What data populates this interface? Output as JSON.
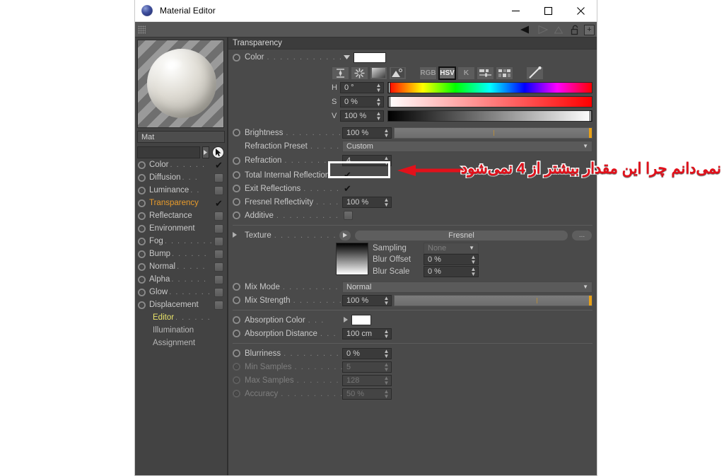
{
  "window": {
    "title": "Material Editor",
    "logo_icon": "cinema4d-sphere-icon",
    "minimize_label": "—",
    "maximize_label": "□",
    "close_label": "✕"
  },
  "toolstrip": {
    "grip_icon": "drag-grip-icon",
    "back_icon": "back-arrow-icon",
    "forward_icon": "forward-arrow-icon",
    "up_icon": "up-arrow-icon",
    "lock_icon": "lock-open-icon",
    "add_icon": "add-box-icon",
    "add_label": "+"
  },
  "preview": {
    "sphere_icon": "material-preview-sphere",
    "material_name": "Mat",
    "search_value": "",
    "search_dropdown_icon": "chevron-right-icon",
    "cursor_icon": "pointer-arrow-icon"
  },
  "channels": [
    {
      "label": "Color",
      "dots": ". . . . . .",
      "state": "checked",
      "active": false
    },
    {
      "label": "Diffusion",
      "dots": ". . .",
      "state": "box",
      "active": false
    },
    {
      "label": "Luminance",
      "dots": ". .",
      "state": "box",
      "active": false
    },
    {
      "label": "Transparency",
      "dots": "",
      "state": "checked",
      "active": true
    },
    {
      "label": "Reflectance",
      "dots": "",
      "state": "box",
      "active": false
    },
    {
      "label": "Environment",
      "dots": "",
      "state": "box",
      "active": false
    },
    {
      "label": "Fog",
      "dots": ". . . . . . . .",
      "state": "box",
      "active": false
    },
    {
      "label": "Bump",
      "dots": ". . . . . .",
      "state": "box",
      "active": false
    },
    {
      "label": "Normal",
      "dots": ". . . . .",
      "state": "box",
      "active": false
    },
    {
      "label": "Alpha",
      "dots": ". . . . . .",
      "state": "box",
      "active": false
    },
    {
      "label": "Glow",
      "dots": ". . . . . . .",
      "state": "box",
      "active": false
    },
    {
      "label": "Displacement",
      "dots": "",
      "state": "box",
      "active": false
    }
  ],
  "sub_pages": [
    {
      "label": "Editor",
      "dots": ". . . . . .",
      "selected": true
    },
    {
      "label": "Illumination",
      "dots": "",
      "selected": false
    },
    {
      "label": "Assignment",
      "dots": "",
      "selected": false
    }
  ],
  "section": {
    "header": "Transparency"
  },
  "color": {
    "label": "Color",
    "dots": ". . . . . . . . . . . .",
    "dropdown_icon": "chevron-down-icon",
    "swatch_hex": "#ffffff",
    "mode_buttons": [
      {
        "name": "range-icon",
        "label": "⧖",
        "selected": false
      },
      {
        "name": "color-wheel-icon",
        "label": "✳",
        "selected": false
      },
      {
        "name": "gradient-icon",
        "label": "",
        "selected": false
      },
      {
        "name": "image-icon",
        "label": "▲",
        "selected": false
      },
      {
        "name": "rgb-mode",
        "label": "RGB",
        "selected": false
      },
      {
        "name": "hsv-mode",
        "label": "HSV",
        "selected": true
      },
      {
        "name": "kelvin-mode",
        "label": "K",
        "selected": false
      },
      {
        "name": "sliders-icon",
        "label": "",
        "selected": false
      },
      {
        "name": "swatches-icon",
        "label": "",
        "selected": false
      },
      {
        "name": "eyedropper-icon",
        "label": "",
        "selected": false
      }
    ],
    "hsv": [
      {
        "channel": "H",
        "value": "0 °",
        "pos_percent": 0
      },
      {
        "channel": "S",
        "value": "0 %",
        "pos_percent": 0
      },
      {
        "channel": "V",
        "value": "100 %",
        "pos_percent": 100
      }
    ]
  },
  "properties": {
    "brightness": {
      "label": "Brightness",
      "dots": ". . . . . . . . . . .",
      "value": "100 %",
      "slider_percent": 100
    },
    "refraction_preset": {
      "label": "Refraction Preset",
      "dots": ". . . . . .",
      "value": "Custom"
    },
    "refraction": {
      "label": "Refraction",
      "dots": ". . . . . . . . . . .",
      "value": "4"
    },
    "total_internal_reflection": {
      "label": "Total Internal Reflection",
      "dots": "",
      "checked": true
    },
    "exit_reflections": {
      "label": "Exit Reflections",
      "dots": ". . . . . . .",
      "checked": true
    },
    "fresnel_reflectivity": {
      "label": "Fresnel Reflectivity",
      "dots": ". . . .",
      "value": "100 %"
    },
    "additive": {
      "label": "Additive",
      "dots": ". . . . . . . . . . . .",
      "checked": false
    },
    "texture": {
      "label": "Texture",
      "dots": ". . . . . . . . . . . .",
      "value": "Fresnel",
      "expand_icon": "triangle-right-icon",
      "play_icon": "triangle-right-icon",
      "browse_label": "..."
    },
    "sampling": {
      "label": "Sampling",
      "value": "None"
    },
    "blur_offset": {
      "label": "Blur Offset",
      "value": "0 %"
    },
    "blur_scale": {
      "label": "Blur Scale",
      "value": "0 %"
    },
    "mix_mode": {
      "label": "Mix Mode",
      "dots": ". . . . . . . . . . .",
      "value": "Normal"
    },
    "mix_strength": {
      "label": "Mix Strength",
      "dots": ". . . . . . . . .",
      "value": "100 %",
      "slider_percent": 100
    },
    "absorption_color": {
      "label": "Absorption Color",
      "dots": ". . .",
      "swatch_hex": "#ffffff",
      "expand_icon": "triangle-right-icon"
    },
    "absorption_distance": {
      "label": "Absorption Distance",
      "dots": ". . .",
      "value": "100 cm"
    },
    "blurriness": {
      "label": "Blurriness",
      "dots": ". . . . . . . . . . .",
      "value": "0 %"
    },
    "min_samples": {
      "label": "Min Samples",
      "dots": ". . . . . . . . .",
      "value": "5",
      "disabled": true
    },
    "max_samples": {
      "label": "Max Samples",
      "dots": ". . . . . . . . .",
      "value": "128",
      "disabled": true
    },
    "accuracy": {
      "label": "Accuracy",
      "dots": ". . . . . . . . . . . .",
      "value": "50 %",
      "disabled": true
    }
  },
  "annotation": {
    "text": "نمی‌دانم چرا این مقدار بیشتر از 4 نمی‌شود",
    "arrow_icon": "left-arrow-annotation",
    "arrow_color": "#e2111b",
    "text_color": "#e2111b",
    "outline_color": "#ffffff"
  }
}
